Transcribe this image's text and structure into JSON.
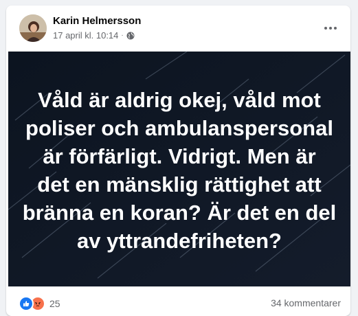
{
  "post": {
    "author": "Karin Helmersson",
    "timestamp": "17 april kl. 10:14",
    "separator": "·",
    "privacy_icon": "globe-icon",
    "more_icon": "more-horizontal-icon",
    "body_lines": [
      "Våld är aldrig okej, våld mot",
      "poliser och ambulanspersonal",
      "är förfärligt. Vidrigt. Men är",
      "det en mänsklig rättighet att",
      "bränna en koran? Är det en del",
      "av yttrandefriheten?"
    ],
    "image_background_color": "#101826",
    "text_color": "#ffffff"
  },
  "footer": {
    "reaction_icons": [
      "like-icon",
      "angry-icon"
    ],
    "reaction_count": "25",
    "comments": "34 kommentarer"
  },
  "colors": {
    "like": "#1877f2",
    "angry": "#f7714c",
    "secondary_text": "#65676b",
    "page_background": "#f0f2f5"
  }
}
